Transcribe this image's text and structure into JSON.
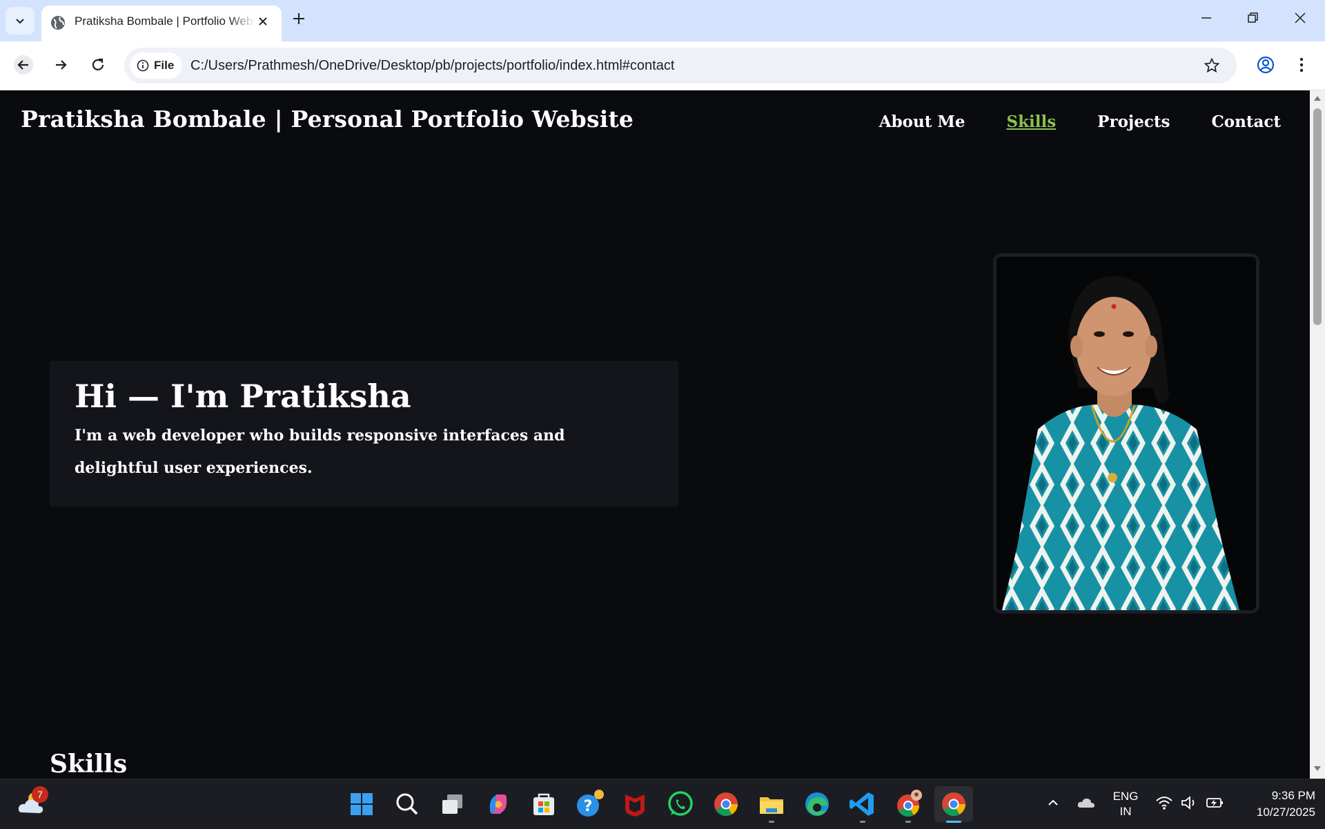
{
  "browser": {
    "tab_title": "Pratiksha Bombale | Portfolio Website",
    "address_chip_label": "File",
    "url": "C:/Users/Prathmesh/OneDrive/Desktop/pb/projects/portfolio/index.html#contact"
  },
  "page": {
    "site_title": "Pratiksha Bombale | Personal Portfolio Website",
    "nav": [
      {
        "label": "About Me",
        "active": false
      },
      {
        "label": "Skills",
        "active": true
      },
      {
        "label": "Projects",
        "active": false
      },
      {
        "label": "Contact",
        "active": false
      }
    ],
    "hero": {
      "heading": "Hi — I'm Pratiksha",
      "subheading": "I'm a web developer who builds responsive interfaces and delightful user experiences."
    },
    "section_title": "Skills",
    "colors": {
      "background": "#0a0b0f",
      "card": "#14151a",
      "accent": "#8bc34a"
    }
  },
  "taskbar": {
    "weather_badge": "7",
    "apps": [
      "start-icon",
      "search-icon",
      "task-view-icon",
      "copilot-icon",
      "store-icon",
      "help-icon",
      "mcafee-icon",
      "whatsapp-icon",
      "chrome-icon",
      "file-explorer-icon",
      "edge-icon",
      "vscode-icon",
      "chrome-profile-icon",
      "chrome-active-icon"
    ],
    "lang_line1": "ENG",
    "lang_line2": "IN",
    "time": "9:36 PM",
    "date": "10/27/2025"
  }
}
